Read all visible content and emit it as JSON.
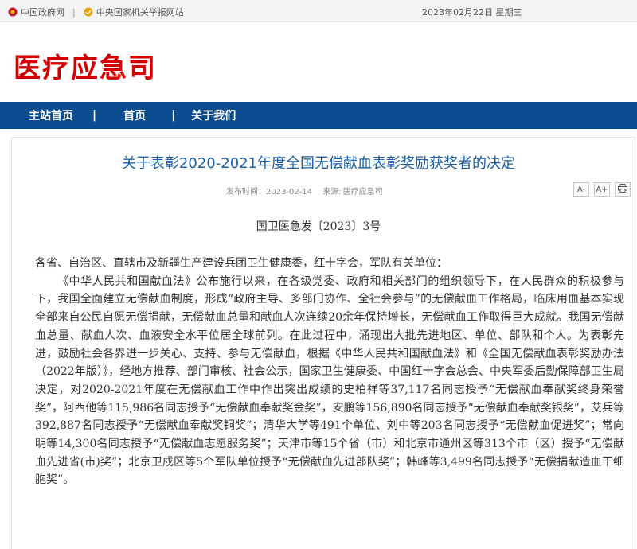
{
  "topbar": {
    "gov_link": "中国政府网",
    "separator": "|",
    "report_link": "中央国家机关举报网站",
    "date": "2023年02月22日 星期三"
  },
  "site": {
    "title": "医疗应急司"
  },
  "nav": {
    "items": [
      "主站首页",
      "首页",
      "关于我们"
    ],
    "divider": "|"
  },
  "article": {
    "title": "关于表彰2020-2021年度全国无偿献血表彰奖励获奖者的决定",
    "published_label": "发布时间：",
    "published_date": "2023-02-14",
    "source_label": "来源:",
    "source": "医疗应急司",
    "tools": {
      "font_small": "A-",
      "font_large": "A+",
      "print": "print"
    },
    "doc_number": "国卫医急发〔2023〕3号",
    "greeting": "各省、自治区、直辖市及新疆生产建设兵团卫生健康委，红十字会，军队有关单位：",
    "paragraph": "《中华人民共和国献血法》公布施行以来，在各级党委、政府和相关部门的组织领导下，在人民群众的积极参与下，我国全面建立无偿献血制度，形成“政府主导、多部门协作、全社会参与”的无偿献血工作格局，临床用血基本实现全部来自公民自愿无偿捐献，无偿献血总量和献血人次连续20余年保持增长，无偿献血工作取得巨大成就。我国无偿献血总量、献血人次、血液安全水平位居全球前列。在此过程中，涌现出大批先进地区、单位、部队和个人。为表彰先进，鼓励社会各界进一步关心、支持、参与无偿献血，根据《中华人民共和国献血法》和《全国无偿献血表彰奖励办法（2022年版）》，经地方推荐、部门审核、社会公示，国家卫生健康委、中国红十字会总会、中央军委后勤保障部卫生局决定，对2020-2021年度在无偿献血工作中作出突出成绩的史柏祥等37,117名同志授予“无偿献血奉献奖终身荣誉奖”，阿西他等115,986名同志授予“无偿献血奉献奖金奖”，安鹏等156,890名同志授予“无偿献血奉献奖银奖”，艾兵等392,887名同志授予“无偿献血奉献奖铜奖”；清华大学等491个单位、刘中等203名同志授予“无偿献血促进奖”；常向明等14,300名同志授予“无偿献血志愿服务奖”；天津市等15个省（市）和北京市通州区等313个市（区）授予“无偿献血先进省(市)奖”；北京卫戍区等5个军队单位授予“无偿献血先进部队奖”；韩峰等3,499名同志授予“无偿捐献造血干细胞奖”。"
  }
}
